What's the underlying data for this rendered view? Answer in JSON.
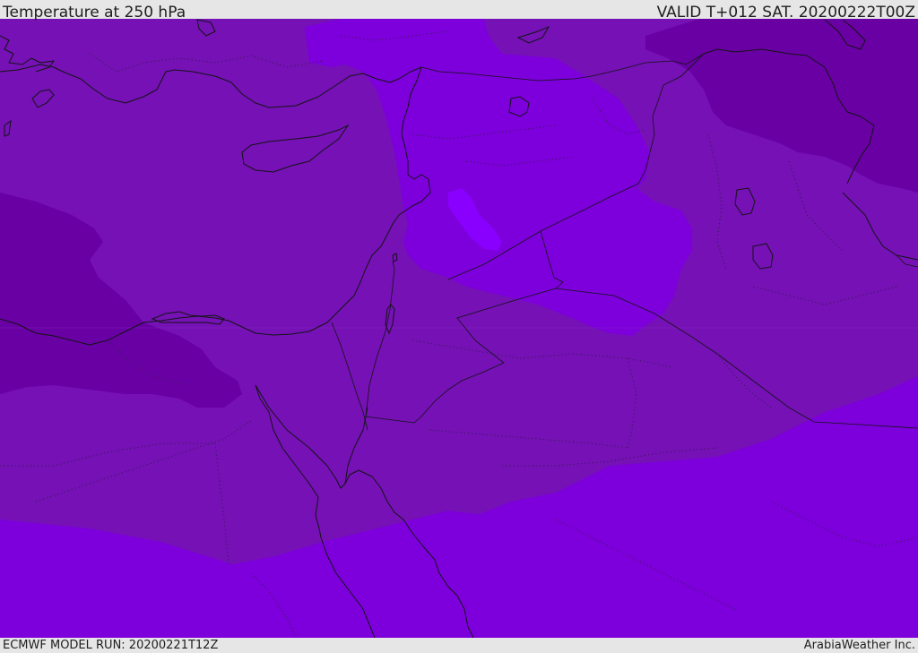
{
  "header": {
    "title": "Temperature at 250 hPa",
    "valid_time": "VALID T+012 SAT. 20200222T00Z"
  },
  "footer": {
    "model_run": "ECMWF MODEL RUN: 20200221T12Z",
    "credit": "ArabiaWeather Inc."
  },
  "colors": {
    "background": "#e6e6e6",
    "temp_band_cold": "#6900a4",
    "temp_band_mid": "#7511b5",
    "temp_band_warm": "#7d00dc",
    "temp_band_warmest": "#8a00ff",
    "coastline": "#141414"
  }
}
